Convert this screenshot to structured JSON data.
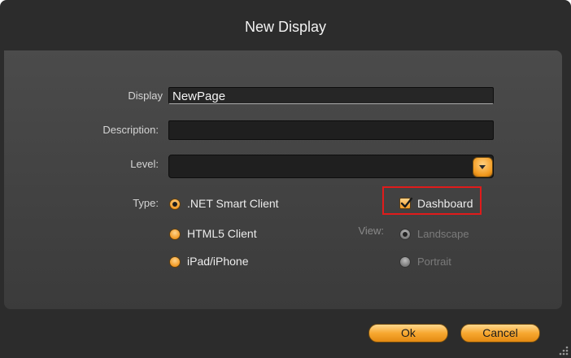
{
  "dialog": {
    "title": "New Display"
  },
  "form": {
    "display_label": "Display",
    "display_value": "NewPage",
    "description_label": "Description:",
    "description_value": "",
    "level_label": "Level:",
    "level_value": "",
    "type_label": "Type:",
    "type_options": [
      {
        "label": ".NET Smart Client",
        "selected": true
      },
      {
        "label": "HTML5 Client",
        "selected": false
      },
      {
        "label": "iPad/iPhone",
        "selected": false
      }
    ],
    "dashboard_label": "Dashboard",
    "dashboard_checked": true,
    "view_label": "View:",
    "view_options": [
      {
        "label": "Landscape",
        "selected": true,
        "enabled": false
      },
      {
        "label": "Portrait",
        "selected": false,
        "enabled": false
      }
    ]
  },
  "buttons": {
    "ok_label": "Ok",
    "cancel_label": "Cancel"
  },
  "colors": {
    "accent": "#f29a25",
    "highlight": "#e01b1b",
    "background": "#2c2c2c"
  }
}
